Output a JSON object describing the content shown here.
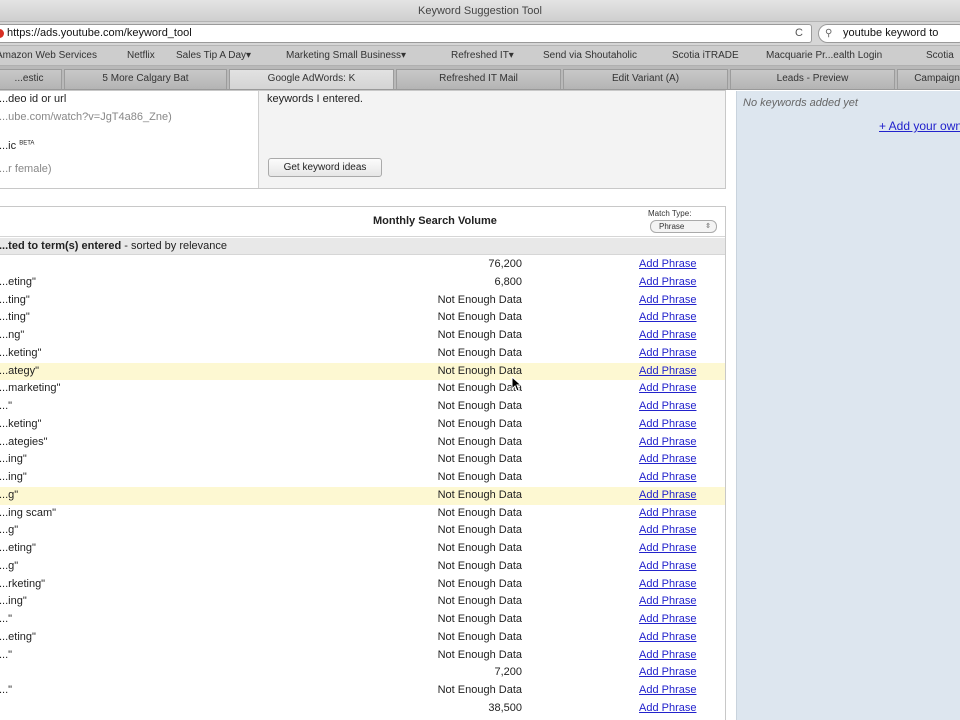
{
  "browser": {
    "title": "Keyword Suggestion Tool",
    "url": "https://ads.youtube.com/keyword_tool",
    "search_value": "youtube keyword to",
    "reload_glyph": "C"
  },
  "bookmarks": [
    "Amazon Web Services",
    "Netflix",
    "Sales Tip A Day▾",
    "Marketing Small Business▾",
    "Refreshed IT▾",
    "Send via Shoutaholic",
    "Scotia iTRADE",
    "Macquarie Pr...ealth Login",
    "Scotia"
  ],
  "tabs": [
    "...estic",
    "5 More Calgary Bat",
    "Google AdWords: K",
    "Refreshed IT Mail",
    "Edit Variant (A)",
    "Leads - Preview",
    "Campaign"
  ],
  "form": {
    "left_label": "...deo id or url",
    "left_hint": "...ube.com/watch?v=JgT4a86_Zne)",
    "left_label2": "...ic",
    "beta_mark": "BETA",
    "left_hint2": "...r female)",
    "right_text": "keywords I entered.",
    "button_label": "Get keyword ideas"
  },
  "sidebar": {
    "empty_text": "No keywords added yet",
    "add_own_link": "+ Add your own"
  },
  "results": {
    "volume_header": "Monthly Search Volume",
    "match_type_label": "Match Type:",
    "match_type_value": "Phrase",
    "sort_bold": "...ted to term(s) entered",
    "sort_rest": " - sorted by relevance",
    "rows": [
      {
        "kw": "",
        "vol": "76,200",
        "action": "Add Phrase"
      },
      {
        "kw": "...eting\"",
        "vol": "6,800",
        "action": "Add Phrase"
      },
      {
        "kw": "...ting\"",
        "vol": "Not Enough Data",
        "action": "Add Phrase"
      },
      {
        "kw": "...ting\"",
        "vol": "Not Enough Data",
        "action": "Add Phrase"
      },
      {
        "kw": "...ng\"",
        "vol": "Not Enough Data",
        "action": "Add Phrase"
      },
      {
        "kw": "...keting\"",
        "vol": "Not Enough Data",
        "action": "Add Phrase"
      },
      {
        "kw": "...ategy\"",
        "vol": "Not Enough Data",
        "action": "Add Phrase"
      },
      {
        "kw": "...marketing\"",
        "vol": "Not Enough Data",
        "action": "Add Phrase"
      },
      {
        "kw": "...\"",
        "vol": "Not Enough Data",
        "action": "Add Phrase"
      },
      {
        "kw": "...keting\"",
        "vol": "Not Enough Data",
        "action": "Add Phrase"
      },
      {
        "kw": "...ategies\"",
        "vol": "Not Enough Data",
        "action": "Add Phrase"
      },
      {
        "kw": "...ing\"",
        "vol": "Not Enough Data",
        "action": "Add Phrase"
      },
      {
        "kw": "...ing\"",
        "vol": "Not Enough Data",
        "action": "Add Phrase"
      },
      {
        "kw": "...g\"",
        "vol": "Not Enough Data",
        "action": "Add Phrase"
      },
      {
        "kw": "...ing scam\"",
        "vol": "Not Enough Data",
        "action": "Add Phrase"
      },
      {
        "kw": "...g\"",
        "vol": "Not Enough Data",
        "action": "Add Phrase"
      },
      {
        "kw": "...eting\"",
        "vol": "Not Enough Data",
        "action": "Add Phrase"
      },
      {
        "kw": "...g\"",
        "vol": "Not Enough Data",
        "action": "Add Phrase"
      },
      {
        "kw": "...rketing\"",
        "vol": "Not Enough Data",
        "action": "Add Phrase"
      },
      {
        "kw": "...ing\"",
        "vol": "Not Enough Data",
        "action": "Add Phrase"
      },
      {
        "kw": "...\"",
        "vol": "Not Enough Data",
        "action": "Add Phrase"
      },
      {
        "kw": "...eting\"",
        "vol": "Not Enough Data",
        "action": "Add Phrase"
      },
      {
        "kw": "...\"",
        "vol": "Not Enough Data",
        "action": "Add Phrase"
      },
      {
        "kw": "",
        "vol": "7,200",
        "action": "Add Phrase"
      },
      {
        "kw": "...\"",
        "vol": "Not Enough Data",
        "action": "Add Phrase"
      },
      {
        "kw": "",
        "vol": "38,500",
        "action": "Add Phrase"
      }
    ]
  },
  "colors": {
    "link": "#2222cc",
    "highlight_row": "#fdf8d2",
    "sidebar_bg": "#dde6ef"
  }
}
